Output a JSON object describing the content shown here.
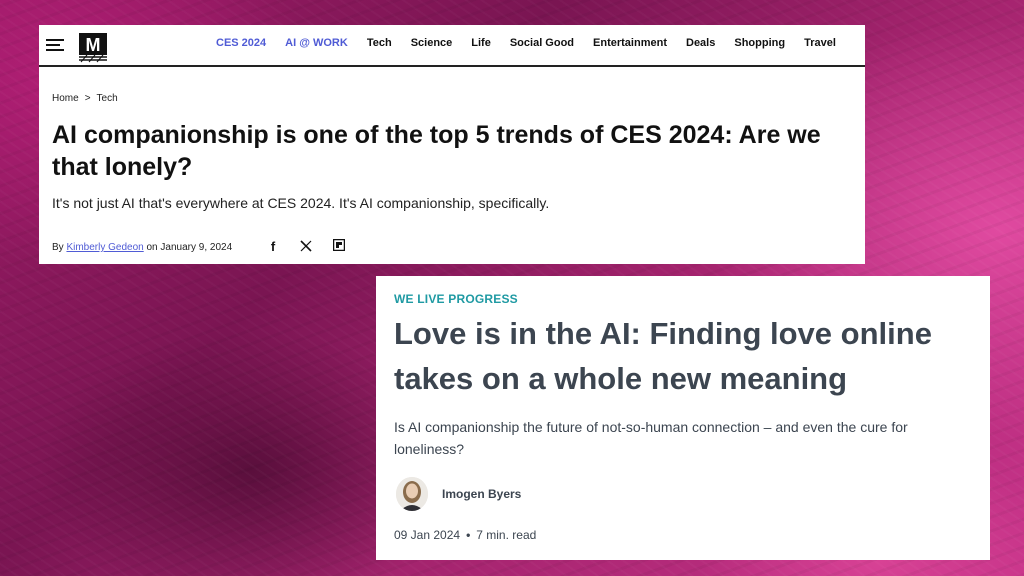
{
  "card1": {
    "nav": {
      "items": [
        {
          "label": "CES 2024",
          "accent": true
        },
        {
          "label": "AI @ WORK",
          "accent": true
        },
        {
          "label": "Tech",
          "accent": false
        },
        {
          "label": "Science",
          "accent": false
        },
        {
          "label": "Life",
          "accent": false
        },
        {
          "label": "Social Good",
          "accent": false
        },
        {
          "label": "Entertainment",
          "accent": false
        },
        {
          "label": "Deals",
          "accent": false
        },
        {
          "label": "Shopping",
          "accent": false
        },
        {
          "label": "Travel",
          "accent": false
        }
      ],
      "accent_color": "#4f5bd5",
      "menu_icon": "hamburger-menu-icon",
      "logo_letter": "M"
    },
    "breadcrumb": {
      "home": "Home",
      "separator": ">",
      "current": "Tech"
    },
    "headline": "AI companionship is one of the top 5 trends of CES 2024: Are we that lonely?",
    "dek": "It's not just AI that's everywhere at CES 2024. It's AI companionship, specifically.",
    "byline": {
      "prefix": "By",
      "author": "Kimberly Gedeon",
      "date_prefix": "on",
      "date": "January 9, 2024"
    },
    "share_icons": [
      "facebook-icon",
      "x-icon",
      "flipboard-icon"
    ]
  },
  "card2": {
    "kicker": "WE LIVE PROGRESS",
    "kicker_color": "#1f9aa3",
    "headline": "Love is in the AI: Finding love online takes on a whole new meaning",
    "dek": "Is AI companionship the future of not-so-human connection – and even the cure for loneliness?",
    "author": "Imogen Byers",
    "date": "09 Jan 2024",
    "read_time": "7 min. read"
  }
}
